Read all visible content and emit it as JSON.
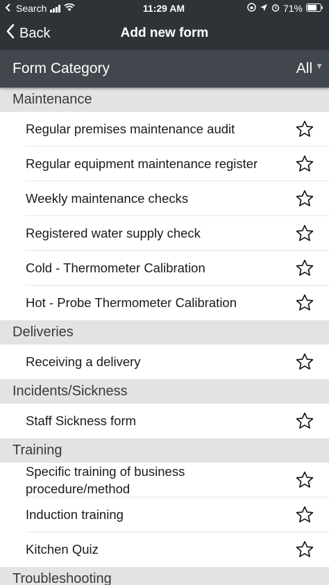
{
  "status_bar": {
    "back_app": "Search",
    "time": "11:29 AM",
    "battery": "71%"
  },
  "nav": {
    "back_label": "Back",
    "title": "Add new form"
  },
  "category": {
    "label": "Form Category",
    "value": "All"
  },
  "sections": [
    {
      "title": "Maintenance",
      "items": [
        "Regular premises maintenance audit",
        "Regular equipment maintenance register",
        "Weekly maintenance checks",
        "Registered water supply check",
        "Cold - Thermometer Calibration",
        "Hot - Probe Thermometer Calibration"
      ]
    },
    {
      "title": "Deliveries",
      "items": [
        "Receiving a delivery"
      ]
    },
    {
      "title": "Incidents/Sickness",
      "items": [
        "Staff Sickness form"
      ]
    },
    {
      "title": "Training",
      "items": [
        "Specific training of business procedure/method",
        "Induction training",
        "Kitchen Quiz"
      ]
    },
    {
      "title": "Troubleshooting",
      "items": []
    }
  ]
}
